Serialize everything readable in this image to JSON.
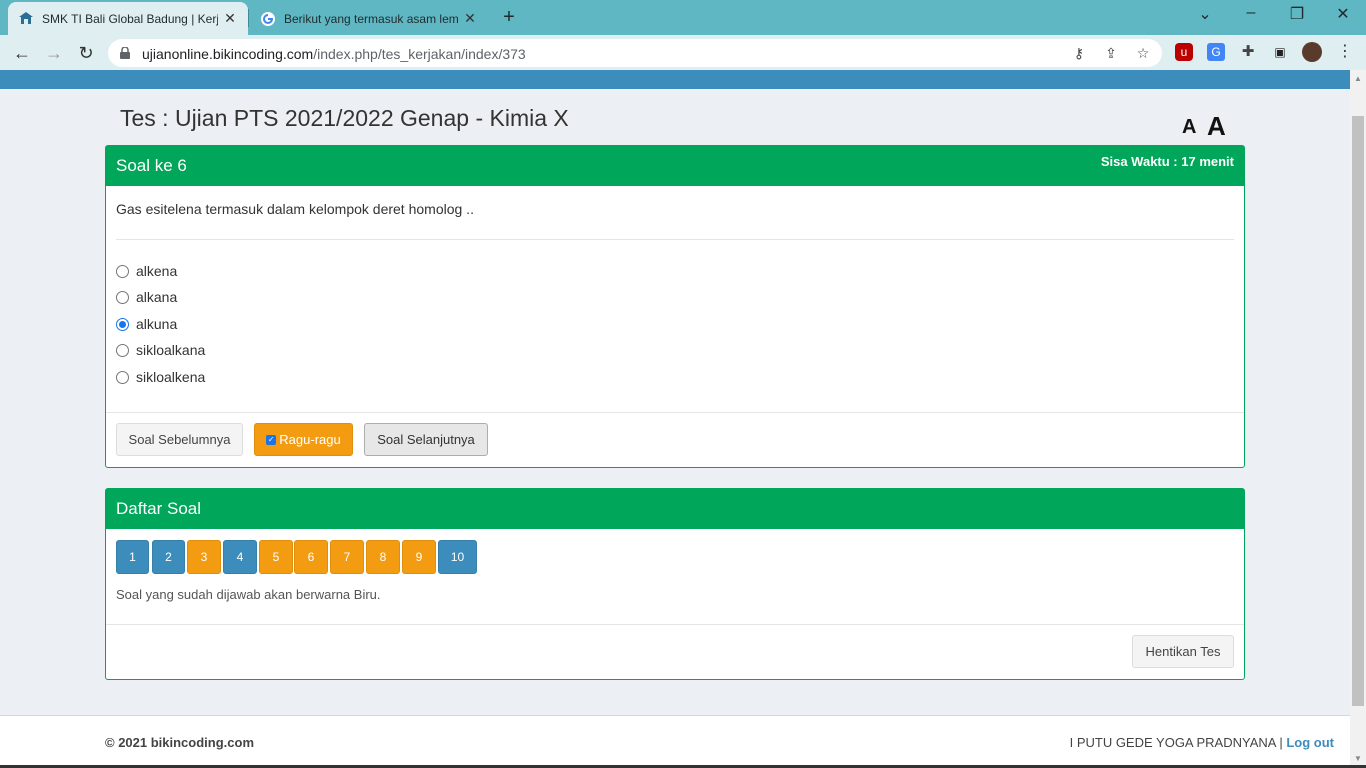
{
  "browser": {
    "tabs": [
      {
        "title": "SMK TI Bali Global Badung | Kerja",
        "active": true
      },
      {
        "title": "Berikut yang termasuk asam lem",
        "active": false
      }
    ],
    "url_host": "ujianonline.bikincoding.com",
    "url_path": "/index.php/tes_kerjakan/index/373"
  },
  "page": {
    "title": "Tes : Ujian PTS 2021/2022 Genap - Kimia X",
    "font_small": "A",
    "font_large": "A"
  },
  "question_box": {
    "heading": "Soal ke 6",
    "timer": "Sisa Waktu : 17 menit",
    "question": "Gas esitelena termasuk dalam kelompok deret homolog ..",
    "options": [
      {
        "label": "alkena",
        "selected": false
      },
      {
        "label": "alkana",
        "selected": false
      },
      {
        "label": "alkuna",
        "selected": true
      },
      {
        "label": "sikloalkana",
        "selected": false
      },
      {
        "label": "sikloalkena",
        "selected": false
      }
    ],
    "prev_button": "Soal Sebelumnya",
    "doubt_button": "Ragu-ragu",
    "next_button": "Soal Selanjutnya"
  },
  "list_box": {
    "heading": "Daftar Soal",
    "questions": [
      {
        "number": "1",
        "status": "answered"
      },
      {
        "number": "2",
        "status": "answered"
      },
      {
        "number": "3",
        "status": "doubt"
      },
      {
        "number": "4",
        "status": "answered"
      },
      {
        "number": "5",
        "status": "doubt"
      },
      {
        "number": "6",
        "status": "doubt"
      },
      {
        "number": "7",
        "status": "doubt"
      },
      {
        "number": "8",
        "status": "doubt"
      },
      {
        "number": "9",
        "status": "doubt"
      },
      {
        "number": "10",
        "status": "answered"
      }
    ],
    "hint": "Soal yang sudah dijawab akan berwarna Biru.",
    "stop_button": "Hentikan Tes"
  },
  "footer": {
    "copyright": "© 2021 bikincoding.com",
    "user": "I PUTU GEDE YOGA PRADNYANA |",
    "logout": "Log out"
  },
  "colors": {
    "header_green": "#00a65a",
    "answered_blue": "#3c8dbc",
    "doubt_orange": "#f39c12"
  }
}
